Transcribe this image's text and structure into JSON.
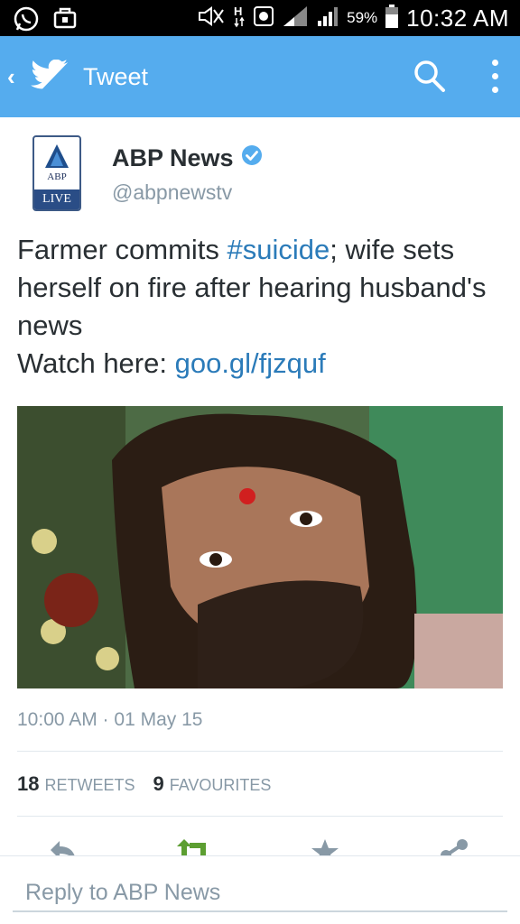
{
  "status_bar": {
    "battery_percent": "59%",
    "time": "10:32 AM",
    "icons": [
      "whatsapp-icon",
      "bag-icon",
      "mute-icon",
      "h-data-icon",
      "sync-icon",
      "signal-icon",
      "battery-icon"
    ]
  },
  "app_bar": {
    "title": "Tweet",
    "icons": [
      "back-icon",
      "twitter-bird-icon",
      "search-icon",
      "more-vert-icon"
    ],
    "color": "#55acee"
  },
  "tweet": {
    "avatar": {
      "top_text": "ABP",
      "bottom_text": "LIVE"
    },
    "author_name": "ABP News",
    "verified": true,
    "handle": "@abpnewstv",
    "text": {
      "line1_pre": "Farmer commits ",
      "hashtag": "#suicide",
      "line1_post": "; wife sets herself on fire after hearing husband's news",
      "line2_pre": "Watch here: ",
      "link": "goo.gl/fjzquf"
    },
    "timestamp": "10:00 AM · 01 May 15",
    "retweets_count": "18",
    "retweets_label": "RETWEETS",
    "favourites_count": "9",
    "favourites_label": "FAVOURITES",
    "action_icons": [
      "reply-icon",
      "retweet-icon",
      "favorite-icon",
      "share-icon"
    ],
    "link_color": "#2b7bb9"
  },
  "reply": {
    "placeholder": "Reply to ABP News"
  }
}
